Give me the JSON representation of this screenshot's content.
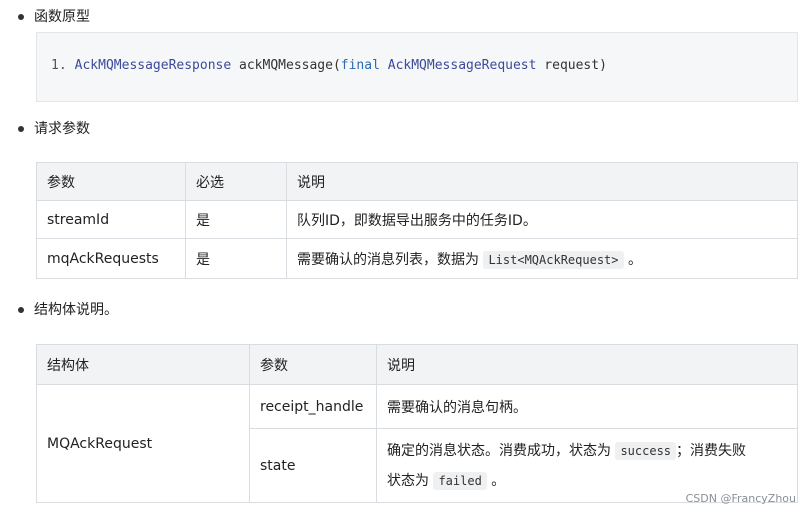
{
  "section1": {
    "heading": "函数原型"
  },
  "code": {
    "line_no": "1.",
    "return_type": "AckMQMessageResponse",
    "method": "ackMQMessage(",
    "keyword": "final",
    "param_type": "AckMQMessageRequest",
    "param_name": "request)"
  },
  "section2": {
    "heading": "请求参数"
  },
  "params_table": {
    "headers": [
      "参数",
      "必选",
      "说明"
    ],
    "rows": [
      {
        "name": "streamId",
        "required": "是",
        "desc": "队列ID，即数据导出服务中的任务ID。"
      },
      {
        "name": "mqAckRequests",
        "required": "是",
        "desc_prefix": "需要确认的消息列表，数据为",
        "desc_code": "List<MQAckRequest>",
        "desc_suffix": "。"
      }
    ]
  },
  "section3": {
    "heading": "结构体说明。"
  },
  "struct_table": {
    "headers": [
      "结构体",
      "参数",
      "说明"
    ],
    "struct_name": "MQAckRequest",
    "rows": [
      {
        "param": "receipt_handle",
        "desc": "需要确认的消息句柄。"
      },
      {
        "param": "state",
        "desc_line1_prefix": "确定的消息状态。消费成功，状态为",
        "desc_code1": "success",
        "desc_line1_suffix": "；消费失败",
        "desc_line2_prefix": "状态为",
        "desc_code2": "failed",
        "desc_line2_suffix": "。"
      }
    ]
  },
  "watermarks": {
    "csdn": "CSDN @FrancyZhou"
  }
}
